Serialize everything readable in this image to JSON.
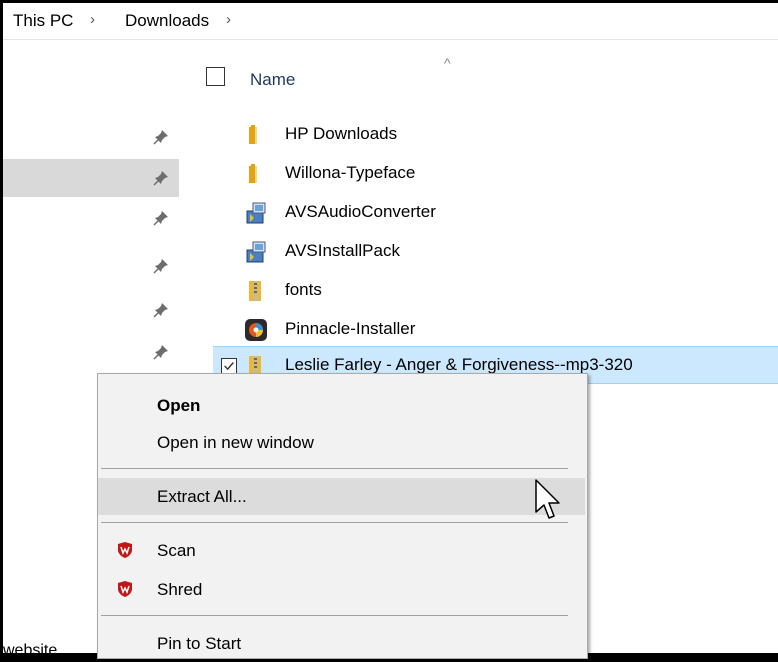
{
  "breadcrumb": {
    "items": [
      "This PC",
      "Downloads"
    ],
    "separator": "›"
  },
  "file_list": {
    "header": {
      "name_label": "Name"
    },
    "items": [
      {
        "name": "HP Downloads",
        "icon": "folder-icon"
      },
      {
        "name": "Willona-Typeface",
        "icon": "folder-icon"
      },
      {
        "name": "AVSAudioConverter",
        "icon": "installer-icon"
      },
      {
        "name": "AVSInstallPack",
        "icon": "installer-icon"
      },
      {
        "name": "fonts",
        "icon": "zip-folder-icon"
      },
      {
        "name": "Pinnacle-Installer",
        "icon": "pinnacle-app-icon"
      },
      {
        "name": "Leslie Farley - Anger & Forgiveness--mp3-320",
        "icon": "zip-folder-icon",
        "selected": true,
        "checked": true
      }
    ]
  },
  "nav_pane": {
    "bottom_text": "website"
  },
  "context_menu": {
    "items": [
      {
        "label": "Open",
        "bold": true
      },
      {
        "label": "Open in new window"
      },
      {
        "label": "Extract All...",
        "hovered": true
      },
      {
        "label": "Scan",
        "icon": "mcafee-shield-icon"
      },
      {
        "label": "Shred",
        "icon": "mcafee-shield-icon"
      },
      {
        "label": "Pin to Start"
      }
    ]
  },
  "colors": {
    "selection_bg": "#cce8ff",
    "menu_bg": "#f2f2f2",
    "menu_hover": "#dcdcdc",
    "nav_selected": "#d9d9d9",
    "mcafee_red": "#c01818"
  }
}
